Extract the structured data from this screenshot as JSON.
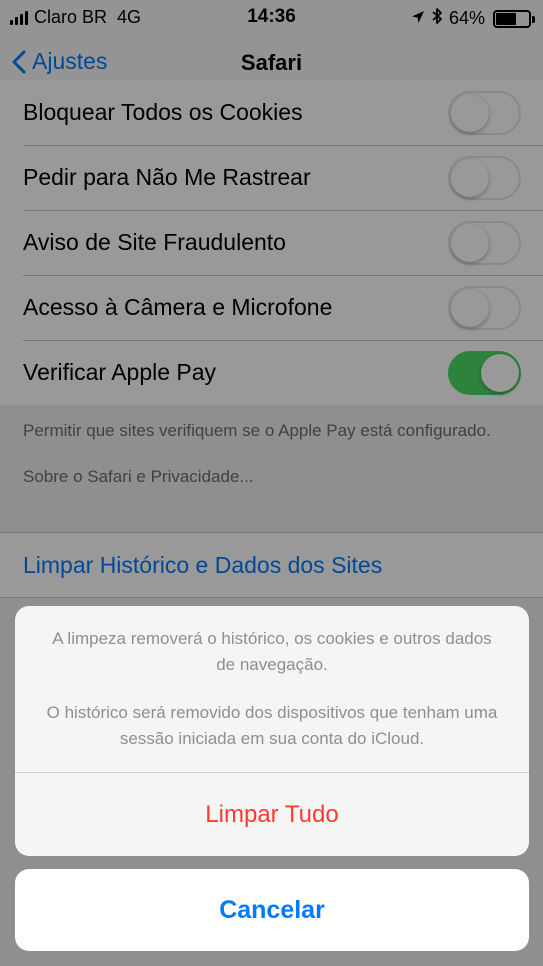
{
  "status_bar": {
    "carrier": "Claro BR",
    "network": "4G",
    "time": "14:36",
    "battery": "64%",
    "battery_level": 0.64,
    "icons": [
      "signal-icon",
      "location-icon",
      "bluetooth-icon",
      "battery-icon"
    ]
  },
  "nav": {
    "back_label": "Ajustes",
    "title": "Safari"
  },
  "settings": [
    {
      "label": "Bloquear Todos os Cookies",
      "on": false
    },
    {
      "label": "Pedir para Não Me Rastrear",
      "on": false
    },
    {
      "label": "Aviso de Site Fraudulento",
      "on": false
    },
    {
      "label": "Acesso à Câmera e Microfone",
      "on": false
    },
    {
      "label": "Verificar Apple Pay",
      "on": true
    }
  ],
  "footer": {
    "note": "Permitir que sites verifiquem se o Apple Pay está configurado.",
    "link": "Sobre o Safari e Privacidade..."
  },
  "clear_history_label": "Limpar Histórico e Dados dos Sites",
  "sheet": {
    "message_1": "A limpeza removerá o histórico, os cookies e outros dados de navegação.",
    "message_2": "O histórico será removido dos dispositivos que tenham uma sessão iniciada em sua conta do iCloud.",
    "action_label": "Limpar Tudo",
    "cancel_label": "Cancelar"
  },
  "colors": {
    "accent": "#007aff",
    "destructive": "#ff3b30",
    "toggle_on": "#4cd964"
  }
}
